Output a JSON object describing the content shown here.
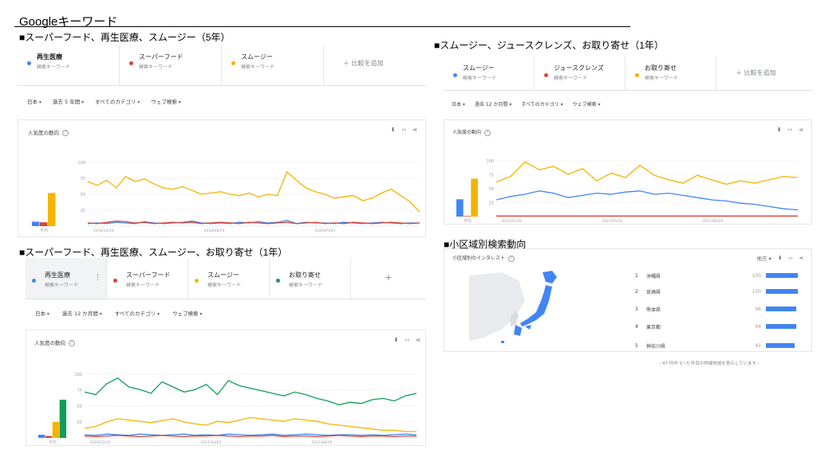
{
  "page_title": "Googleキーワード",
  "colors": {
    "blue": "#4285f4",
    "red": "#db4437",
    "yellow": "#f4b400",
    "green": "#0f9d58"
  },
  "sec1": {
    "heading": "■スーパーフード、再生医療、スムージー（5年）",
    "keywords": [
      {
        "name": "再生医療",
        "sub": "検索キーワード",
        "color": "blue"
      },
      {
        "name": "スーパーフード",
        "sub": "検索キーワード",
        "color": "red"
      },
      {
        "name": "スムージー",
        "sub": "検索キーワード",
        "color": "yellow"
      }
    ],
    "add_compare": "比較を追加",
    "filters": [
      "日本",
      "過去 5 年間",
      "すべてのカテゴリ",
      "ウェブ検索"
    ],
    "card_title": "人気度の動向",
    "avg_label": "平均",
    "x_ticks": [
      "2016/12/18",
      "2018/08/26",
      "2020/05/03"
    ],
    "y_ticks": [
      "100",
      "75",
      "50",
      "25"
    ]
  },
  "sec2": {
    "heading": "■スムージー、ジュースクレンズ、お取り寄せ（1年）",
    "keywords": [
      {
        "name": "スムージー",
        "sub": "検索キーワード",
        "color": "blue"
      },
      {
        "name": "ジュースクレンズ",
        "sub": "検索キーワード",
        "color": "red"
      },
      {
        "name": "お取り寄せ",
        "sub": "検索キーワード",
        "color": "yellow"
      }
    ],
    "add_compare": "比較を追加",
    "filters": [
      "日本",
      "過去 12 か月間",
      "すべてのカテゴリ",
      "ウェブ検索"
    ],
    "card_title": "人気度の動向",
    "avg_label": "平均",
    "x_ticks": [
      "2020/12/20",
      "2021/05/16",
      "2021/08/29"
    ],
    "y_ticks": [
      "100",
      "75",
      "50",
      "25"
    ]
  },
  "sec3": {
    "heading": "■スーパーフード、再生医療、スムージー、お取り寄せ（1年）",
    "keywords": [
      {
        "name": "再生医療",
        "sub": "検索キーワード",
        "color": "blue"
      },
      {
        "name": "スーパーフード",
        "sub": "検索キーワード",
        "color": "red"
      },
      {
        "name": "スムージー",
        "sub": "検索キーワード",
        "color": "yellow"
      },
      {
        "name": "お取り寄せ",
        "sub": "検索キーワード",
        "color": "green"
      }
    ],
    "add_symbol": "+",
    "more_symbol": "⋮",
    "filters": [
      "日本",
      "過去 12 か月間",
      "すべてのカテゴリ",
      "ウェブ検索"
    ],
    "card_title": "人気度の動向",
    "avg_label": "平均",
    "x_ticks": [
      "2020/12/20",
      "2021/04/25",
      "2021/08/29"
    ],
    "y_ticks": [
      "100",
      "75",
      "50",
      "25"
    ]
  },
  "sec4": {
    "heading": "■小区域別検索動向",
    "card_title": "小区域別のインタレスト",
    "region_select": "地方",
    "regions": [
      {
        "rank": "1",
        "name": "沖縄県",
        "value": "100",
        "fill": 1.0
      },
      {
        "rank": "2",
        "name": "宮崎県",
        "value": "100",
        "fill": 1.0
      },
      {
        "rank": "3",
        "name": "熊本県",
        "value": "96",
        "fill": 0.96
      },
      {
        "rank": "4",
        "name": "東京都",
        "value": "94",
        "fill": 0.94
      },
      {
        "rank": "5",
        "name": "神奈川県",
        "value": "91",
        "fill": 0.91
      }
    ],
    "pager": "47 件中 1～5 件目の詳細地域を表示しています"
  },
  "chart_data": [
    {
      "type": "line",
      "title": "人気度の動向",
      "ylim": [
        0,
        100
      ],
      "series": [
        {
          "name": "再生医療",
          "color": "#4285f4",
          "values": [
            4,
            5,
            4,
            6,
            5,
            4,
            7,
            5,
            4,
            5,
            6,
            8,
            5,
            4,
            5,
            4,
            6,
            5,
            7,
            5,
            6,
            9,
            4,
            6,
            5,
            5,
            4,
            6,
            5,
            4,
            5,
            6,
            5,
            4,
            5,
            5
          ],
          "average": 7
        },
        {
          "name": "スーパーフード",
          "color": "#db4437",
          "values": [
            5,
            4,
            6,
            8,
            7,
            5,
            6,
            4,
            5,
            6,
            5,
            6,
            4,
            5,
            6,
            5,
            4,
            6,
            5,
            4,
            5,
            6,
            4,
            5,
            6,
            4,
            5,
            4,
            6,
            5,
            4,
            5,
            6,
            5,
            4,
            5
          ],
          "average": 6
        },
        {
          "name": "スムージー",
          "color": "#f4b400",
          "values": [
            70,
            64,
            72,
            60,
            78,
            70,
            74,
            66,
            60,
            58,
            62,
            56,
            50,
            52,
            54,
            50,
            48,
            52,
            46,
            50,
            48,
            85,
            72,
            60,
            54,
            50,
            44,
            46,
            48,
            40,
            44,
            52,
            58,
            48,
            38,
            22
          ],
          "average": 52
        }
      ]
    },
    {
      "type": "line",
      "title": "人気度の動向",
      "ylim": [
        0,
        100
      ],
      "series": [
        {
          "name": "スムージー",
          "color": "#4285f4",
          "values": [
            30,
            36,
            40,
            46,
            42,
            34,
            38,
            42,
            40,
            44,
            46,
            40,
            42,
            38,
            34,
            30,
            28,
            24,
            22,
            18,
            14,
            12
          ],
          "average": 31
        },
        {
          "name": "ジュースクレンズ",
          "color": "#db4437",
          "values": [
            1,
            1,
            1,
            1,
            1,
            1,
            1,
            1,
            1,
            1,
            1,
            1,
            1,
            1,
            1,
            1,
            1,
            1,
            1,
            1,
            1,
            1
          ],
          "average": 1
        },
        {
          "name": "お取り寄せ",
          "color": "#f4b400",
          "values": [
            62,
            72,
            98,
            84,
            90,
            76,
            86,
            64,
            78,
            70,
            92,
            74,
            66,
            60,
            74,
            66,
            58,
            64,
            60,
            66,
            72,
            70
          ],
          "average": 68
        }
      ]
    },
    {
      "type": "line",
      "title": "人気度の動向",
      "ylim": [
        0,
        100
      ],
      "series": [
        {
          "name": "再生医療",
          "color": "#4285f4",
          "values": [
            5,
            4,
            6,
            5,
            4,
            6,
            5,
            4,
            5,
            6,
            4,
            5,
            4,
            6,
            5,
            4,
            5,
            6,
            4,
            5,
            6,
            5,
            4,
            5,
            5,
            4,
            5,
            4,
            5,
            6,
            5
          ],
          "average": 5
        },
        {
          "name": "スーパーフード",
          "color": "#db4437",
          "values": [
            3,
            2,
            3,
            4,
            3,
            2,
            3,
            4,
            3,
            2,
            3,
            3,
            4,
            3,
            2,
            3,
            3,
            4,
            2,
            3,
            3,
            2,
            3,
            4,
            3,
            2,
            3,
            3,
            2,
            3,
            3
          ],
          "average": 3
        },
        {
          "name": "スムージー",
          "color": "#f4b400",
          "values": [
            15,
            18,
            25,
            30,
            28,
            26,
            24,
            27,
            30,
            25,
            22,
            20,
            26,
            24,
            28,
            32,
            30,
            28,
            26,
            30,
            28,
            26,
            22,
            20,
            18,
            16,
            14,
            12,
            12,
            10,
            10
          ],
          "average": 25
        },
        {
          "name": "お取り寄せ",
          "color": "#0f9d58",
          "values": [
            72,
            68,
            85,
            94,
            80,
            76,
            70,
            88,
            80,
            72,
            76,
            84,
            68,
            90,
            82,
            78,
            74,
            70,
            66,
            72,
            68,
            62,
            58,
            52,
            56,
            54,
            60,
            62,
            58,
            66,
            70
          ],
          "average": 60
        }
      ]
    }
  ]
}
